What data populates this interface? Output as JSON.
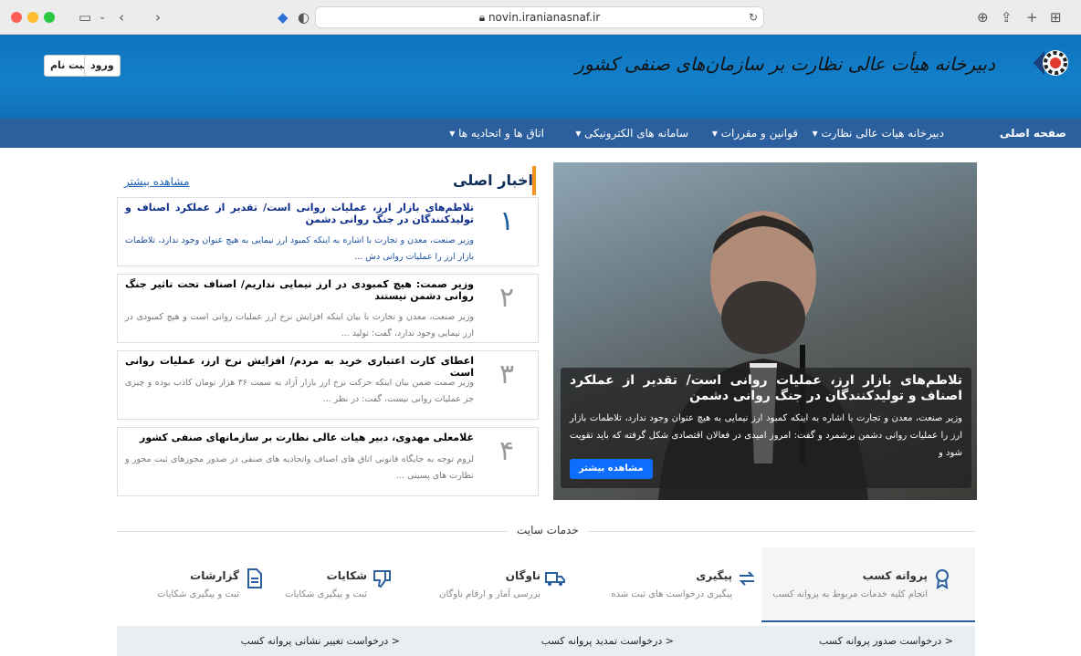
{
  "browser": {
    "url": "novin.iranianasnaf.ir"
  },
  "header": {
    "brand_title": "دبیرخانه هیأت عالی نظارت بر سازمان‌های صنفی کشور",
    "login_label": "ورود",
    "signup_label": "ثبت نام"
  },
  "nav": {
    "items": [
      {
        "label": "صفحه اصلی"
      },
      {
        "label": "دبیرخانه هیات عالی نظارت ▾"
      },
      {
        "label": "قوانین و مقررات ▾"
      },
      {
        "label": "سامانه های الکترونیکی ▾"
      },
      {
        "label": "اتاق ها و اتحادیه ها ▾"
      }
    ]
  },
  "main_news": {
    "title": "اخبار اصلی",
    "see_more": "مشاهده بیشتر",
    "items": [
      {
        "num": "۱",
        "title": "تلاطم‌های بازار ارز، عملیات روانی است/ تقدیر از عملکرد اصناف و تولیدکنندگان در جنگ روانی دشمن",
        "desc": "وزیر صنعت، معدن و تجارت با اشاره به اینکه کمبود ارز نیمایی به هیچ عنوان وجود ندارد، تلاطمات بازار ارز را عملیات روانی دش ..."
      },
      {
        "num": "۲",
        "title": "وزیر صمت: هیچ کمبودی در ارز نیمایی نداریم/ اصناف تحت تاثیر جنگ روانی دشمن نیستند",
        "desc": "وزیر صنعت، معدن و تجارت با بیان اینکه افزایش نرخ ارز عملیات روانی است و هیچ کمبودی در ارز نیمایی وجود ندارد، گفت: تولید ..."
      },
      {
        "num": "۳",
        "title": "اعطای کارت اعتباری خرید به مردم/ افزایش نرخ ارز، عملیات روانی است",
        "desc": "وزیر صمت ضمن بیان اینکه حرکت نرخ ارز بازار آزاد به سمت ۳۶ هزار تومان کاذب بوده و چیزی جز عملیات روانی نیست، گفت: در نظر ..."
      },
      {
        "num": "۴",
        "title": "غلامعلی مهدوی، دبیر هیات عالی نظارت بر سازمانهای صنفی کشور",
        "desc": "لزوم توجه به جایگاه قانونی اتاق های اصناف واتحادیه های صنفی در صدور مجوزهای ثبت محور و نظارت های پسینی ..."
      }
    ]
  },
  "hero": {
    "title": "تلاطم‌های بازار ارز، عملیات روانی است/ تقدیر از عملکرد اصناف و تولیدکنندگان در جنگ روانی دشمن",
    "desc": "وزیر صنعت، معدن و تجارت با اشاره به اینکه کمبود ارز نیمایی به هیچ عنوان وجود ندارد، تلاطمات بازار ارز را عملیات روانی دشمن برشمرد و گفت: امروز امیدی در فعالان اقتصادی شکل گرفته که باید تقویت شود و",
    "more": "مشاهده بیشتر"
  },
  "services": {
    "label": "خدمات سایت",
    "items": [
      {
        "title": "پروانه کسب",
        "desc": "انجام کلیه خدمات مربوط به پروانه کسب",
        "icon": "badge-icon"
      },
      {
        "title": "پیگیری",
        "desc": "پیگیری درخواست های ثبت شده",
        "icon": "refresh-arrows-icon"
      },
      {
        "title": "ناوگان",
        "desc": "بررسی آمار و ارقام ناوگان",
        "icon": "truck-icon"
      },
      {
        "title": "شکایات",
        "desc": "ثبت و پیگیری شکایات",
        "icon": "thumbs-down-icon"
      },
      {
        "title": "گزارشات",
        "desc": "ثبت و پیگیری شکایات",
        "icon": "document-icon"
      }
    ],
    "sub_links": [
      {
        "label": "< درخواست صدور پروانه کسب"
      },
      {
        "label": "< درخواست تمدید پروانه کسب"
      },
      {
        "label": "< درخواست تغییر نشانی پروانه کسب"
      }
    ]
  }
}
